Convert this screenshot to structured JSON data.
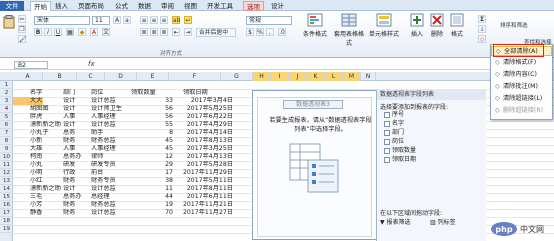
{
  "tabs": [
    "文件",
    "开始",
    "插入",
    "页面布局",
    "公式",
    "数据",
    "审阅",
    "视图",
    "开发工具",
    "选项",
    "设计"
  ],
  "ribbon": {
    "font_name": "宋体",
    "font_size": "11",
    "alignment_group_label": "对齐方式",
    "merge_label": "合并后居中",
    "number_format": "常规",
    "conditional_format": "条件格式",
    "table_format": "套用表格格式",
    "cell_styles": "单元格样式",
    "insert": "插入",
    "delete": "删除",
    "format": "格式",
    "sort_filter": "排序和筛选",
    "find_select": "查找和选择",
    "sum_icon": "Σ",
    "clipboard_icon": "clipboard-icon"
  },
  "formula_bar": {
    "name_box": "B2",
    "fx": "fx"
  },
  "columns": [
    "A",
    "B",
    "C",
    "D",
    "E",
    "F",
    "G",
    "H",
    "I",
    "J",
    "K",
    "L",
    "M",
    "N",
    "O",
    "P",
    "Q",
    "R"
  ],
  "rows": [
    "1",
    "2",
    "3",
    "4",
    "5",
    "6",
    "7",
    "8",
    "9",
    "10",
    "11",
    "12",
    "13",
    "14",
    "15",
    "16",
    "17",
    "18",
    "19"
  ],
  "table": {
    "headers": [
      "名字",
      "部门",
      "岗位",
      "领取数量",
      "领取日期"
    ],
    "data": [
      [
        "大大",
        "设计",
        "设计总监",
        "33",
        "2017年3月4日"
      ],
      [
        "胡图图",
        "设计",
        "设计师卫生",
        "56",
        "2017年5月25日"
      ],
      [
        "胖虎",
        "人事",
        "人事经理",
        "56",
        "2017年6月22日"
      ],
      [
        "漂新新之助",
        "设计",
        "设计总监",
        "55",
        "2017年4月29日"
      ],
      [
        "小丸子",
        "总务",
        "助手",
        "8",
        "2017年4月14日"
      ],
      [
        "小新",
        "财务",
        "财务总监",
        "45",
        "2017年8月13日"
      ],
      [
        "大雄",
        "人事",
        "人事经理",
        "45",
        "2017年3月25日"
      ],
      [
        "柯南",
        "总务办",
        "律师",
        "12",
        "2017年4月13日"
      ],
      [
        "小丸",
        "研发",
        "研发专员",
        "29",
        "2017年5月28日"
      ],
      [
        "小明",
        "行政",
        "前台",
        "17",
        "2017年11月29日"
      ],
      [
        "小红",
        "财务",
        "财务专员",
        "38",
        "2017年5月11日"
      ],
      [
        "漂新新之助",
        "设计",
        "设计总监",
        "11",
        "2017年8月11日"
      ],
      [
        "三毛",
        "总务办",
        "总经理",
        "44",
        "2017年6月11日"
      ],
      [
        "小芳",
        "财务",
        "财务总监",
        "19",
        "2017年11月21日"
      ],
      [
        "静香",
        "财务",
        "设计总监",
        "70",
        "2017年11月27日"
      ]
    ]
  },
  "pivot": {
    "title": "数据透视表3",
    "hint": "若要生成报表，请从“数据透视表字段列表”中选择字段。"
  },
  "field_list": {
    "title": "数据透视表字段列表",
    "prompt": "选择要添加到报表的字段:",
    "fields": [
      "序号",
      "名字",
      "部门",
      "岗位",
      "领取数量",
      "领取日期"
    ],
    "drag_prompt": "在以下区域间拖动字段:",
    "report_filter": "报表筛选",
    "column_labels": "列标签"
  },
  "menu": {
    "items": [
      {
        "label": "全部清除(A)",
        "icon": "eraser-icon"
      },
      {
        "label": "清除格式(F)",
        "icon": "format-eraser-icon"
      },
      {
        "label": "清除内容(C)",
        "icon": "content-eraser-icon"
      },
      {
        "label": "清除批注(M)",
        "icon": "comment-eraser-icon"
      },
      {
        "label": "清除超链接(L)",
        "icon": "link-eraser-icon"
      },
      {
        "label": "删除超链接(R)",
        "icon": "link-remove-icon"
      }
    ]
  },
  "watermark": "php中文网",
  "colors": {
    "accent": "#2f66b3",
    "selection": "#f9c66b",
    "highlight_box": "#e2231a"
  }
}
